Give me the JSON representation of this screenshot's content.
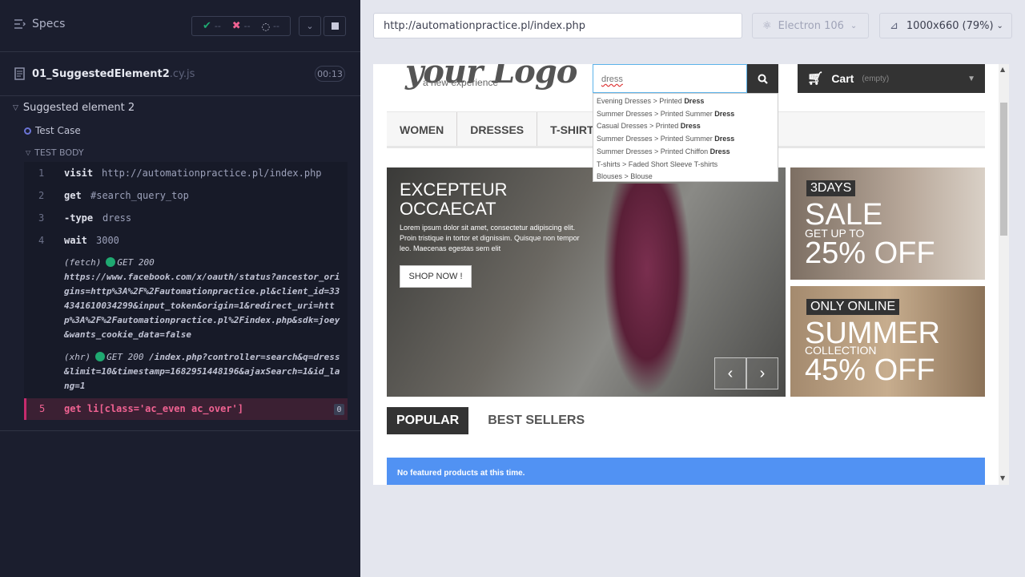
{
  "runner": {
    "specs_label": "Specs",
    "passed": "--",
    "failed": "--",
    "pending": "--",
    "file_name": "01_SuggestedElement2",
    "file_ext": ".cy.js",
    "duration": "00:13",
    "suite_title": "Suggested element 2",
    "test_title": "Test Case",
    "section_title": "TEST BODY",
    "commands": [
      {
        "num": "1",
        "name": "visit",
        "arg": "http://automationpractice.pl/index.php"
      },
      {
        "num": "2",
        "name": "get",
        "arg": "#search_query_top"
      },
      {
        "num": "3",
        "name": "-type",
        "arg": "dress"
      },
      {
        "num": "4",
        "name": "wait",
        "arg": "3000"
      }
    ],
    "fetch_log": {
      "kind": "(fetch)",
      "status": "GET 200",
      "url": "https://www.facebook.com/x/oauth/status?ancestor_origins=http%3A%2F%2Fautomationpractice.pl&client_id=334341610034299&input_token&origin=1&redirect_uri=http%3A%2F%2Fautomationpractice.pl%2Findex.php&sdk=joey&wants_cookie_data=false"
    },
    "xhr_log": {
      "kind": "(xhr)",
      "status": "GET 200",
      "url": "/index.php?controller=search&q=dress&limit=10&timestamp=1682951448196&ajaxSearch=1&id_lang=1"
    },
    "failing_command": {
      "num": "5",
      "name": "get",
      "arg": "li[class='ac_even ac_over']",
      "count": "0"
    }
  },
  "browser_bar": {
    "url": "http://automationpractice.pl/index.php",
    "browser": "Electron 106",
    "viewport": "1000x660",
    "scale": "(79%)"
  },
  "site": {
    "logo": "your Logo",
    "logo_sub": "a new experience",
    "search_value": "dress",
    "cart_label": "Cart",
    "cart_status": "(empty)",
    "menu": [
      "WOMEN",
      "DRESSES",
      "T-SHIRTS"
    ],
    "suggestions": [
      {
        "prefix": "Evening Dresses > Printed ",
        "bold": "Dress",
        "suffix": ""
      },
      {
        "prefix": "Summer Dresses > Printed Summer ",
        "bold": "Dress",
        "suffix": ""
      },
      {
        "prefix": "Casual Dresses > Printed ",
        "bold": "Dress",
        "suffix": ""
      },
      {
        "prefix": "Summer Dresses > Printed Summer ",
        "bold": "Dress",
        "suffix": ""
      },
      {
        "prefix": "Summer Dresses > Printed Chiffon ",
        "bold": "Dress",
        "suffix": ""
      },
      {
        "prefix": "T-shirts > Faded Short Sleeve T-shirts",
        "bold": "",
        "suffix": ""
      },
      {
        "prefix": "Blouses > Blouse",
        "bold": "",
        "suffix": ""
      }
    ],
    "slider": {
      "title_line1": "EXCEPTEUR",
      "title_line2": "OCCAECAT",
      "text": "Lorem ipsum dolor sit amet, consectetur adipiscing elit. Proin tristique in tortor et dignissim. Quisque non tempor leo. Maecenas egestas sem elit",
      "button": "SHOP NOW !"
    },
    "banner1": {
      "tag": "3DAYS",
      "big": "SALE",
      "mid": "GET UP TO",
      "pct": "25% OFF"
    },
    "banner2": {
      "tag": "ONLY ONLINE",
      "big": "SUMMER",
      "mid": "COLLECTION",
      "pct": "45% OFF"
    },
    "tabs": [
      "POPULAR",
      "BEST SELLERS"
    ],
    "alert": "No featured products at this time."
  },
  "colors": {
    "runner_bg": "#1b1e2e",
    "pass": "#1fa971",
    "fail": "#f06292",
    "alert": "#5192f3"
  }
}
